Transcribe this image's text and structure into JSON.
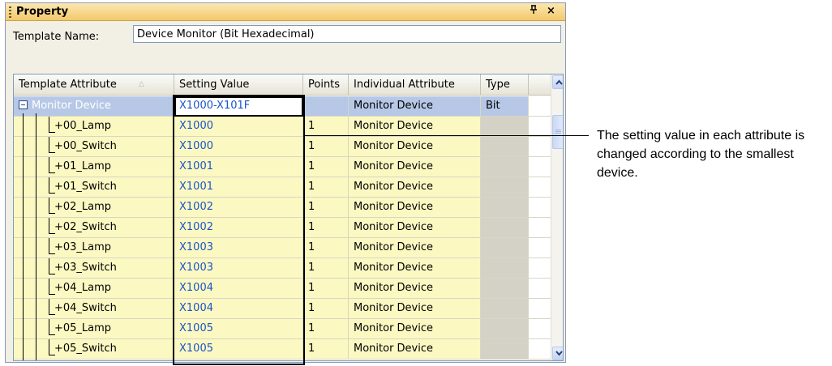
{
  "panel": {
    "title": "Property",
    "pin_glyph": "ꟸ",
    "close_glyph": "×"
  },
  "template": {
    "label": "Template Name:",
    "value": "Device Monitor (Bit Hexadecimal)"
  },
  "grid": {
    "columns": [
      "Template Attribute",
      "Setting Value",
      "Points",
      "Individual Attribute",
      "Type"
    ],
    "parent": {
      "attribute": "Monitor Device",
      "setting_value": "X1000-X101F",
      "points": "",
      "individual": "Monitor Device",
      "type": "Bit"
    },
    "rows": [
      {
        "attribute": "+00_Lamp",
        "setting_value": "X1000",
        "points": "1",
        "individual": "Monitor Device"
      },
      {
        "attribute": "+00_Switch",
        "setting_value": "X1000",
        "points": "1",
        "individual": "Monitor Device"
      },
      {
        "attribute": "+01_Lamp",
        "setting_value": "X1001",
        "points": "1",
        "individual": "Monitor Device"
      },
      {
        "attribute": "+01_Switch",
        "setting_value": "X1001",
        "points": "1",
        "individual": "Monitor Device"
      },
      {
        "attribute": "+02_Lamp",
        "setting_value": "X1002",
        "points": "1",
        "individual": "Monitor Device"
      },
      {
        "attribute": "+02_Switch",
        "setting_value": "X1002",
        "points": "1",
        "individual": "Monitor Device"
      },
      {
        "attribute": "+03_Lamp",
        "setting_value": "X1003",
        "points": "1",
        "individual": "Monitor Device"
      },
      {
        "attribute": "+03_Switch",
        "setting_value": "X1003",
        "points": "1",
        "individual": "Monitor Device"
      },
      {
        "attribute": "+04_Lamp",
        "setting_value": "X1004",
        "points": "1",
        "individual": "Monitor Device"
      },
      {
        "attribute": "+04_Switch",
        "setting_value": "X1004",
        "points": "1",
        "individual": "Monitor Device"
      },
      {
        "attribute": "+05_Lamp",
        "setting_value": "X1005",
        "points": "1",
        "individual": "Monitor Device"
      },
      {
        "attribute": "+05_Switch",
        "setting_value": "X1005",
        "points": "1",
        "individual": "Monitor Device"
      }
    ]
  },
  "callout": {
    "text": "The setting value in each attribute is changed according to the smallest device."
  },
  "colors": {
    "title_bar": "#f3c96b",
    "row_yellow": "#fbf8c2",
    "row_selected": "#b6c8e6",
    "value_text": "#1a54c8"
  }
}
